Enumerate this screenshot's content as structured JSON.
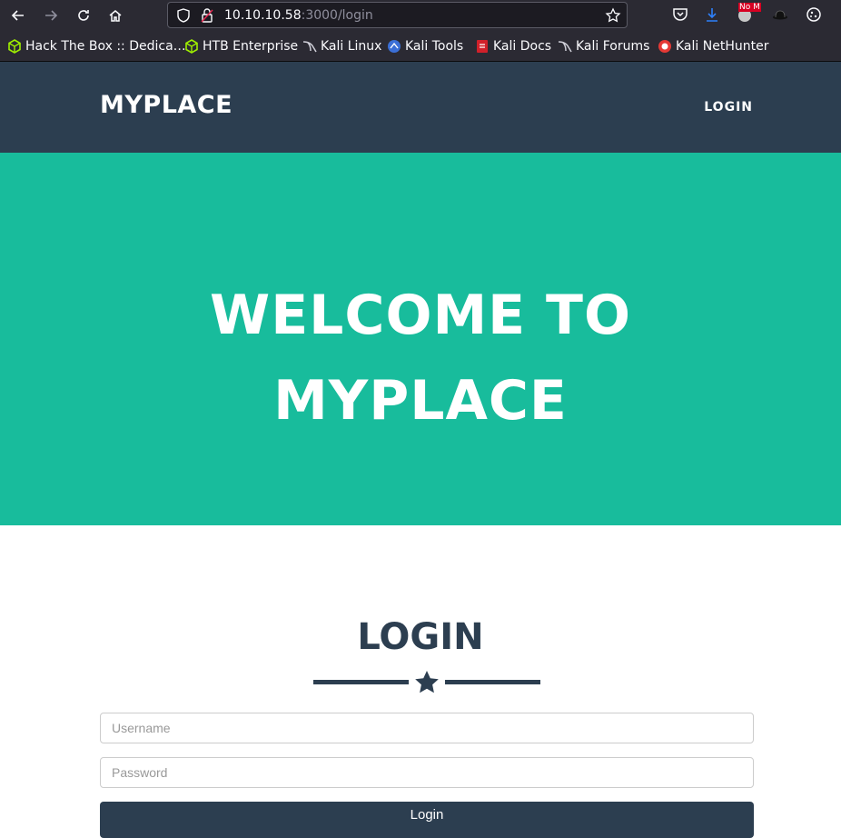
{
  "browser": {
    "url_host": "10.10.10.58",
    "url_rest": ":3000/login",
    "bookmarks": [
      {
        "label": "Hack The Box :: Dedica…",
        "icon": "htb-cube-icon"
      },
      {
        "label": "HTB Enterprise",
        "icon": "htb-cube-icon"
      },
      {
        "label": "Kali Linux",
        "icon": "kali-dragon-icon"
      },
      {
        "label": "Kali Tools",
        "icon": "kali-tools-icon"
      },
      {
        "label": "Kali Docs",
        "icon": "kali-docs-icon"
      },
      {
        "label": "Kali Forums",
        "icon": "kali-dragon-icon"
      },
      {
        "label": "Kali NetHunter",
        "icon": "nethunter-icon"
      }
    ],
    "badge_text": "No M",
    "accent_color": "#18bc9c"
  },
  "site": {
    "brand": "MYPLACE",
    "nav_login": "LOGIN",
    "hero_line1": "WELCOME TO",
    "hero_line2": "MYPLACE",
    "section_title": "LOGIN",
    "username_placeholder": "Username",
    "password_placeholder": "Password",
    "submit_label": "Login",
    "colors": {
      "navbar": "#2c3e50",
      "hero": "#18bc9c",
      "text": "#2c3e50"
    }
  }
}
